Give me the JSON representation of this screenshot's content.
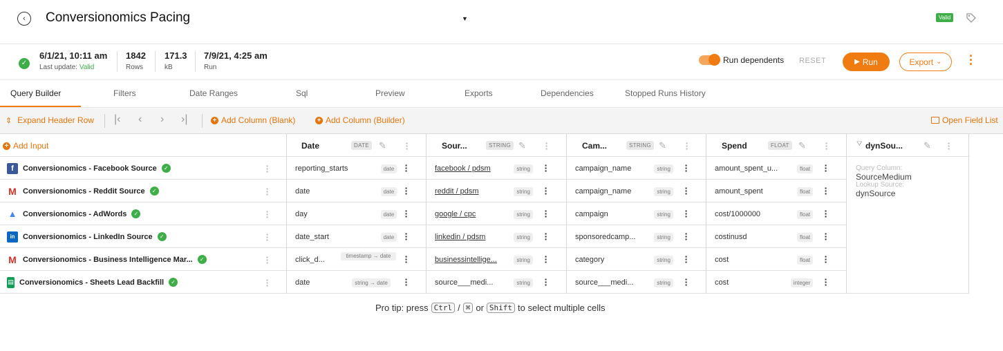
{
  "header": {
    "title": "Conversionomics Pacing",
    "valid_badge": "Valid"
  },
  "info": {
    "last_update_value": "6/1/21, 10:11 am",
    "last_update_label": "Last update:",
    "last_update_status": "Valid",
    "rows_value": "1842",
    "rows_label": "Rows",
    "size_value": "171.3",
    "size_label": "kB",
    "run_value": "7/9/21, 4:25 am",
    "run_label": "Run"
  },
  "actions": {
    "run_dependents": "Run dependents",
    "run_dependents_on": true,
    "reset": "RESET",
    "run": "Run",
    "export": "Export"
  },
  "tabs": [
    "Query Builder",
    "Filters",
    "Date Ranges",
    "Sql",
    "Preview",
    "Exports",
    "Dependencies",
    "Stopped Runs History"
  ],
  "toolbar": {
    "expand_header": "Expand Header Row",
    "add_blank": "Add Column (Blank)",
    "add_builder": "Add Column (Builder)",
    "open_field_list": "Open Field List",
    "add_input": "Add Input"
  },
  "columns": [
    {
      "name": "Date",
      "type": "DATE"
    },
    {
      "name": "Sour...",
      "type": "STRING"
    },
    {
      "name": "Cam...",
      "type": "STRING"
    },
    {
      "name": "Spend",
      "type": "FLOAT"
    },
    {
      "name": "dynSou...",
      "type": ""
    }
  ],
  "sources": [
    {
      "name": "Conversionomics - Facebook Source",
      "icon": "facebook-icon"
    },
    {
      "name": "Conversionomics - Reddit Source",
      "icon": "gmail-icon"
    },
    {
      "name": "Conversionomics - AdWords",
      "icon": "google-ads-icon"
    },
    {
      "name": "Conversionomics - LinkedIn Source",
      "icon": "linkedin-icon"
    },
    {
      "name": "Conversionomics - Business Intelligence Mar...",
      "icon": "gmail-icon"
    },
    {
      "name": "Conversionomics - Sheets Lead Backfill",
      "icon": "google-sheets-icon"
    }
  ],
  "cells": [
    [
      {
        "v": "reporting_starts",
        "t": "date"
      },
      {
        "v": "facebook / pdsm",
        "t": "string"
      },
      {
        "v": "campaign_name",
        "t": "string"
      },
      {
        "v": "amount_spent_u...",
        "t": "float"
      }
    ],
    [
      {
        "v": "date",
        "t": "date"
      },
      {
        "v": "reddit / pdsm",
        "t": "string"
      },
      {
        "v": "campaign_name",
        "t": "string"
      },
      {
        "v": "amount_spent",
        "t": "float"
      }
    ],
    [
      {
        "v": "day",
        "t": "date"
      },
      {
        "v": "google / cpc",
        "t": "string"
      },
      {
        "v": "campaign",
        "t": "string"
      },
      {
        "v": "cost/1000000",
        "t": "float"
      }
    ],
    [
      {
        "v": "date_start",
        "t": "date"
      },
      {
        "v": "linkedin / pdsm",
        "t": "string"
      },
      {
        "v": "sponsoredcamp...",
        "t": "string"
      },
      {
        "v": "costinusd",
        "t": "float"
      }
    ],
    [
      {
        "v": "click_d...",
        "t": "timestamp → date"
      },
      {
        "v": "businessintellige...",
        "t": "string"
      },
      {
        "v": "category",
        "t": "string"
      },
      {
        "v": "cost",
        "t": "float"
      }
    ],
    [
      {
        "v": "date",
        "t": "string → date"
      },
      {
        "v": "source___medi...",
        "t": "string"
      },
      {
        "v": "source___medi...",
        "t": "string"
      },
      {
        "v": "cost",
        "t": "integer"
      }
    ]
  ],
  "dyn_panel": {
    "query_column_label": "Query Column:",
    "query_column_value": "SourceMedium",
    "lookup_source_label": "Lookup Source:",
    "lookup_source_value": "dynSource"
  },
  "protip": {
    "prefix": "Pro tip: press",
    "key1": "Ctrl",
    "slash": "/",
    "key2": "⌘",
    "or": "or",
    "key3": "Shift",
    "suffix": "to select multiple cells"
  },
  "colors": {
    "accent": "#f07b10",
    "success": "#3fae49"
  }
}
